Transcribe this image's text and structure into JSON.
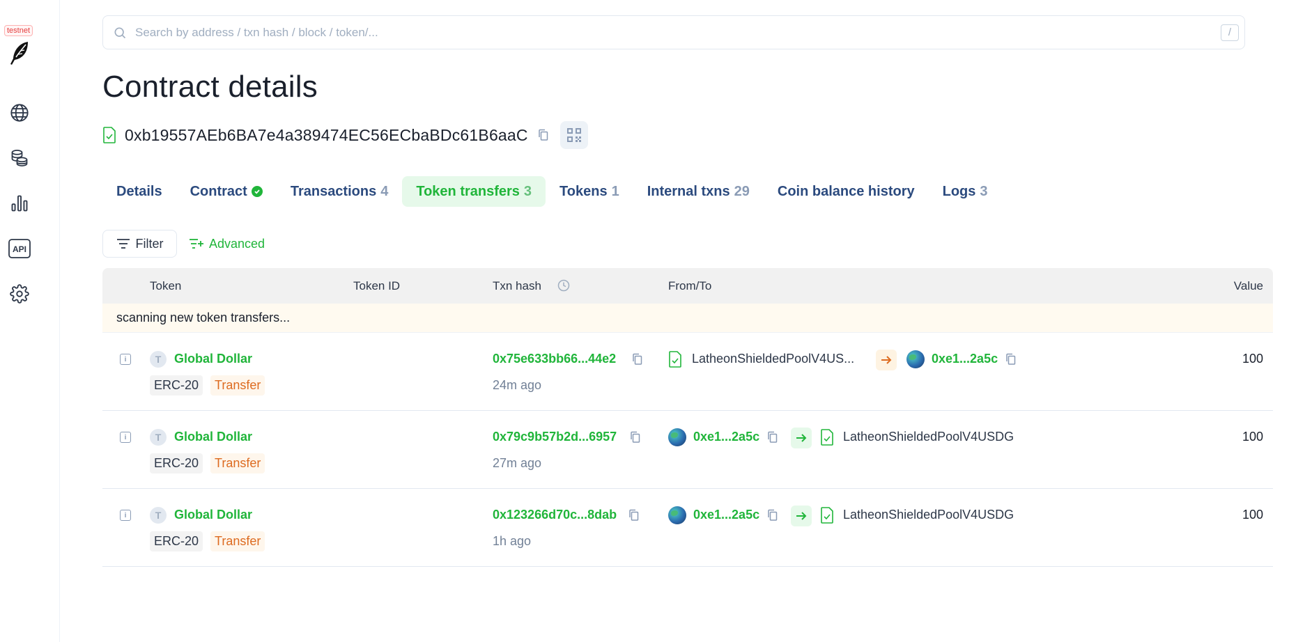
{
  "sidebar": {
    "badge": "testnet",
    "items": [
      {
        "icon": "globe-icon"
      },
      {
        "icon": "coins-icon"
      },
      {
        "icon": "bar-chart-icon"
      },
      {
        "icon": "api-icon",
        "label": "API"
      },
      {
        "icon": "gear-icon"
      }
    ]
  },
  "search": {
    "placeholder": "Search by address / txn hash / block / token/...",
    "shortcut": "/"
  },
  "page": {
    "title": "Contract details",
    "address": "0xb19557AEb6BA7e4a389474EC56ECbaBDc61B6aaC"
  },
  "tabs": [
    {
      "label": "Details",
      "count": ""
    },
    {
      "label": "Contract",
      "count": ""
    },
    {
      "label": "Transactions",
      "count": "4"
    },
    {
      "label": "Token transfers",
      "count": "3"
    },
    {
      "label": "Tokens",
      "count": "1"
    },
    {
      "label": "Internal txns",
      "count": "29"
    },
    {
      "label": "Coin balance history",
      "count": ""
    },
    {
      "label": "Logs",
      "count": "3"
    }
  ],
  "filters": {
    "filter_label": "Filter",
    "advanced_label": "Advanced"
  },
  "table": {
    "columns": {
      "token": "Token",
      "token_id": "Token ID",
      "txn_hash": "Txn hash",
      "from_to": "From/To",
      "value": "Value"
    },
    "scanning": "scanning new token transfers...",
    "rows": [
      {
        "token_initial": "T",
        "token": "Global Dollar",
        "standard": "ERC-20",
        "type": "Transfer",
        "hash": "0x75e633bb66...44e2",
        "age": "24m ago",
        "from": "LatheonShieldedPoolV4US...",
        "to": "0xe1...2a5c",
        "direction": "out",
        "value": "100"
      },
      {
        "token_initial": "T",
        "token": "Global Dollar",
        "standard": "ERC-20",
        "type": "Transfer",
        "hash": "0x79c9b57b2d...6957",
        "age": "27m ago",
        "from": "0xe1...2a5c",
        "to": "LatheonShieldedPoolV4USDG",
        "direction": "in",
        "value": "100"
      },
      {
        "token_initial": "T",
        "token": "Global Dollar",
        "standard": "ERC-20",
        "type": "Transfer",
        "hash": "0x123266d70c...8dab",
        "age": "1h ago",
        "from": "0xe1...2a5c",
        "to": "LatheonShieldedPoolV4USDG",
        "direction": "in",
        "value": "100"
      }
    ]
  },
  "colors": {
    "accent": "#20b53a",
    "tab_link": "#2b4a7e",
    "transfer_tag": "#dd6b20"
  }
}
